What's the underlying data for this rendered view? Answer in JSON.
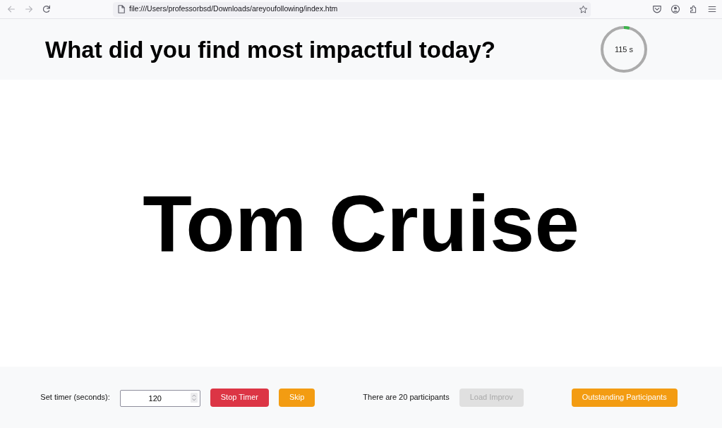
{
  "browser": {
    "nav_buttons": [
      {
        "kind": "back",
        "disabled": true
      },
      {
        "kind": "forward",
        "disabled": true
      },
      {
        "kind": "reload",
        "disabled": false
      }
    ],
    "url": "file:///Users/professorbsd/Downloads/areyoufollowing/index.htm",
    "toolbar_buttons": [
      {
        "kind": "save_page"
      },
      {
        "kind": "account"
      },
      {
        "kind": "extensions"
      },
      {
        "kind": "menu"
      }
    ]
  },
  "header": {
    "question": "What did you find most impactful today?",
    "timer": {
      "reading": "115 s",
      "level": 0.04
    }
  },
  "answer": "Tom Cruise",
  "footer": {
    "groups": [
      {
        "items": [
          {
            "kind": "label",
            "text": "Set timer (seconds):"
          },
          {
            "kind": "number_field",
            "value": "120"
          },
          {
            "kind": "danger_button",
            "label": "Stop Timer",
            "disabled": false
          },
          {
            "kind": "warning_button",
            "label": "Skip",
            "disabled": false
          }
        ]
      },
      {
        "items": [
          {
            "kind": "text",
            "text": "There are 20 participants"
          },
          {
            "kind": "button",
            "label": "Load Improv",
            "disabled": true
          }
        ]
      },
      {
        "items": [
          {
            "kind": "warning_button",
            "label": "Outstanding Participants",
            "disabled": false
          }
        ]
      }
    ]
  }
}
